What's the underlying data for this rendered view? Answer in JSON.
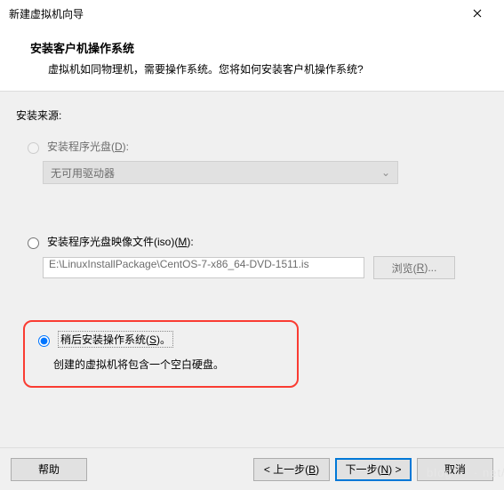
{
  "title": "新建虚拟机向导",
  "header": {
    "title": "安装客户机操作系统",
    "subtitle": "虚拟机如同物理机，需要操作系统。您将如何安装客户机操作系统?"
  },
  "sourceLabel": "安装来源:",
  "option1": {
    "labelPrefix": "安装程序光盘(",
    "accel": "D",
    "labelSuffix": "):",
    "combo": "无可用驱动器"
  },
  "option2": {
    "labelPrefix": "安装程序光盘映像文件(iso)(",
    "accel": "M",
    "labelSuffix": "):",
    "path": "E:\\LinuxInstallPackage\\CentOS-7-x86_64-DVD-1511.is",
    "browsePrefix": "浏览(",
    "browseAccel": "R",
    "browseSuffix": ")..."
  },
  "option3": {
    "labelPrefix": "稍后安装操作系统(",
    "accel": "S",
    "labelSuffix": ")。",
    "hint": "创建的虚拟机将包含一个空白硬盘。"
  },
  "footer": {
    "help": "帮助",
    "backPrefix": "< 上一步(",
    "backAccel": "B",
    "backSuffix": ")",
    "nextPrefix": "下一步(",
    "nextAccel": "N",
    "nextSuffix": ") >",
    "cancel": "取消"
  }
}
